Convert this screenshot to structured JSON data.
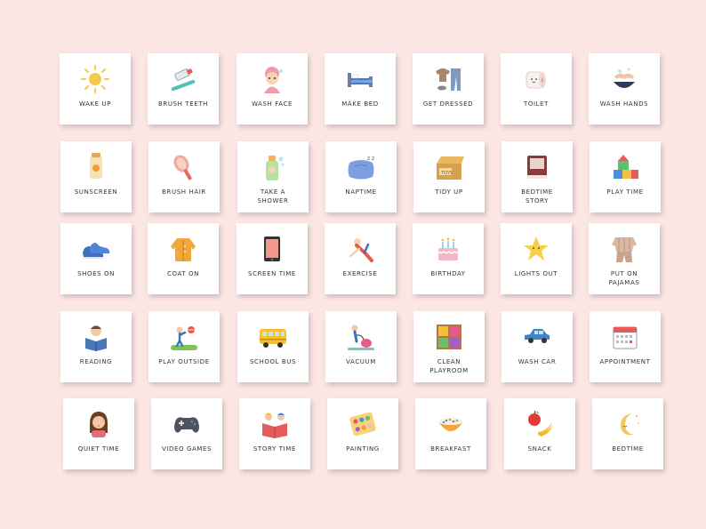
{
  "board": {
    "rows": [
      [
        {
          "label": "WAKE UP",
          "icon": "sun-icon"
        },
        {
          "label": "BRUSH TEETH",
          "icon": "toothbrush-icon"
        },
        {
          "label": "WASH FACE",
          "icon": "wash-face-icon"
        },
        {
          "label": "MAKE BED",
          "icon": "bed-icon"
        },
        {
          "label": "GET DRESSED",
          "icon": "clothes-icon"
        },
        {
          "label": "TOILET",
          "icon": "toilet-paper-icon"
        },
        {
          "label": "WASH HANDS",
          "icon": "wash-hands-icon"
        }
      ],
      [
        {
          "label": "SUNSCREEN",
          "icon": "sunscreen-icon"
        },
        {
          "label": "BRUSH HAIR",
          "icon": "hairbrush-icon"
        },
        {
          "label": "TAKE A\nSHOWER",
          "icon": "shower-bottle-icon"
        },
        {
          "label": "NAPTIME",
          "icon": "pillow-icon"
        },
        {
          "label": "TIDY UP",
          "icon": "toy-box-icon"
        },
        {
          "label": "BEDTIME\nSTORY",
          "icon": "book-icon"
        },
        {
          "label": "PLAY TIME",
          "icon": "blocks-icon"
        }
      ],
      [
        {
          "label": "SHOES ON",
          "icon": "shoes-icon"
        },
        {
          "label": "COAT ON",
          "icon": "coat-icon"
        },
        {
          "label": "SCREEN TIME",
          "icon": "tablet-icon"
        },
        {
          "label": "EXERCISE",
          "icon": "exercise-icon"
        },
        {
          "label": "BIRTHDAY",
          "icon": "birthday-cake-icon"
        },
        {
          "label": "LIGHTS OUT",
          "icon": "star-icon"
        },
        {
          "label": "PUT ON\nPAJAMAS",
          "icon": "pajamas-icon"
        }
      ],
      [
        {
          "label": "READING",
          "icon": "reading-child-icon"
        },
        {
          "label": "PLAY OUTSIDE",
          "icon": "ball-play-icon"
        },
        {
          "label": "SCHOOL BUS",
          "icon": "school-bus-icon"
        },
        {
          "label": "VACUUM",
          "icon": "vacuum-icon"
        },
        {
          "label": "CLEAN\nPLAYROOM",
          "icon": "shelves-icon"
        },
        {
          "label": "WASH CAR",
          "icon": "car-icon"
        },
        {
          "label": "APPOINTMENT",
          "icon": "calendar-icon"
        }
      ],
      [
        {
          "label": "QUIET TIME",
          "icon": "quiet-girl-icon"
        },
        {
          "label": "VIDEO GAMES",
          "icon": "game-controller-icon"
        },
        {
          "label": "STORY TIME",
          "icon": "story-book-icon"
        },
        {
          "label": "PAINTING",
          "icon": "paint-palette-icon"
        },
        {
          "label": "BREAKFAST",
          "icon": "cereal-bowl-icon"
        },
        {
          "label": "SNACK",
          "icon": "fruit-icon"
        },
        {
          "label": "BEDTIME",
          "icon": "moon-icon"
        }
      ]
    ]
  }
}
